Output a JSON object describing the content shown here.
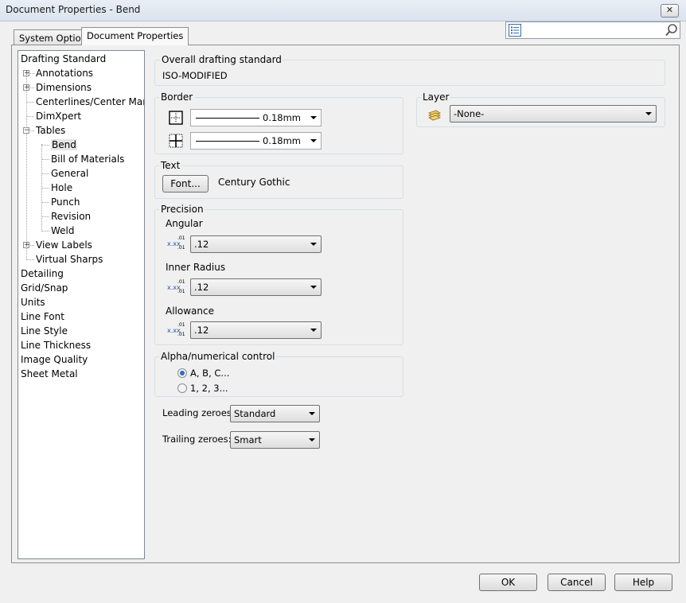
{
  "window": {
    "title": "Document Properties - Bend",
    "close_label": "✕"
  },
  "tabs": [
    {
      "label": "System Options",
      "active": false
    },
    {
      "label": "Document Properties",
      "active": true
    }
  ],
  "search": {
    "value": "",
    "placeholder": ""
  },
  "tree": [
    {
      "label": "Drafting Standard",
      "level": 0
    },
    {
      "label": "Annotations",
      "level": 1,
      "expander": "+"
    },
    {
      "label": "Dimensions",
      "level": 1,
      "expander": "+"
    },
    {
      "label": "Centerlines/Center Marks",
      "level": 1
    },
    {
      "label": "DimXpert",
      "level": 1
    },
    {
      "label": "Tables",
      "level": 1,
      "expander": "−"
    },
    {
      "label": "Bend",
      "level": 2,
      "selected": true
    },
    {
      "label": "Bill of Materials",
      "level": 2
    },
    {
      "label": "General",
      "level": 2
    },
    {
      "label": "Hole",
      "level": 2
    },
    {
      "label": "Punch",
      "level": 2
    },
    {
      "label": "Revision",
      "level": 2
    },
    {
      "label": "Weld",
      "level": 2
    },
    {
      "label": "View Labels",
      "level": 1,
      "expander": "+"
    },
    {
      "label": "Virtual Sharps",
      "level": 1
    },
    {
      "label": "Detailing",
      "level": 0
    },
    {
      "label": "Grid/Snap",
      "level": 0
    },
    {
      "label": "Units",
      "level": 0
    },
    {
      "label": "Line Font",
      "level": 0
    },
    {
      "label": "Line Style",
      "level": 0
    },
    {
      "label": "Line Thickness",
      "level": 0
    },
    {
      "label": "Image Quality",
      "level": 0
    },
    {
      "label": "Sheet Metal",
      "level": 0
    }
  ],
  "drafting": {
    "title": "Overall drafting standard",
    "value": "ISO-MODIFIED"
  },
  "border": {
    "title": "Border",
    "line1_value": "0.18mm",
    "line2_value": "0.18mm"
  },
  "layer": {
    "title": "Layer",
    "value": "-None-"
  },
  "text": {
    "title": "Text",
    "font_button": "Font...",
    "font_name": "Century Gothic"
  },
  "precision": {
    "title": "Precision",
    "angular_label": "Angular",
    "angular_value": ".12",
    "inner_radius_label": "Inner Radius",
    "inner_radius_value": ".12",
    "allowance_label": "Allowance",
    "allowance_value": ".12",
    "icon_main": "x.xx",
    "icon_sup": ".01",
    "icon_sub": ".01"
  },
  "alpha": {
    "title": "Alpha/numerical control",
    "option1": "A, B, C...",
    "option2": "1, 2, 3...",
    "selected": "option1"
  },
  "leading": {
    "label": "Leading zeroes:",
    "value": "Standard"
  },
  "trailing": {
    "label": "Trailing zeroes:",
    "value": "Smart"
  },
  "footer": {
    "ok": "OK",
    "cancel": "Cancel",
    "help": "Help"
  },
  "icons": {
    "close": "close-icon",
    "options": "options-list-icon",
    "search": "magnifier-icon",
    "border1": "border-box-icon",
    "border2": "border-cross-icon",
    "layer": "layer-stack-icon",
    "precision": "precision-icon"
  }
}
